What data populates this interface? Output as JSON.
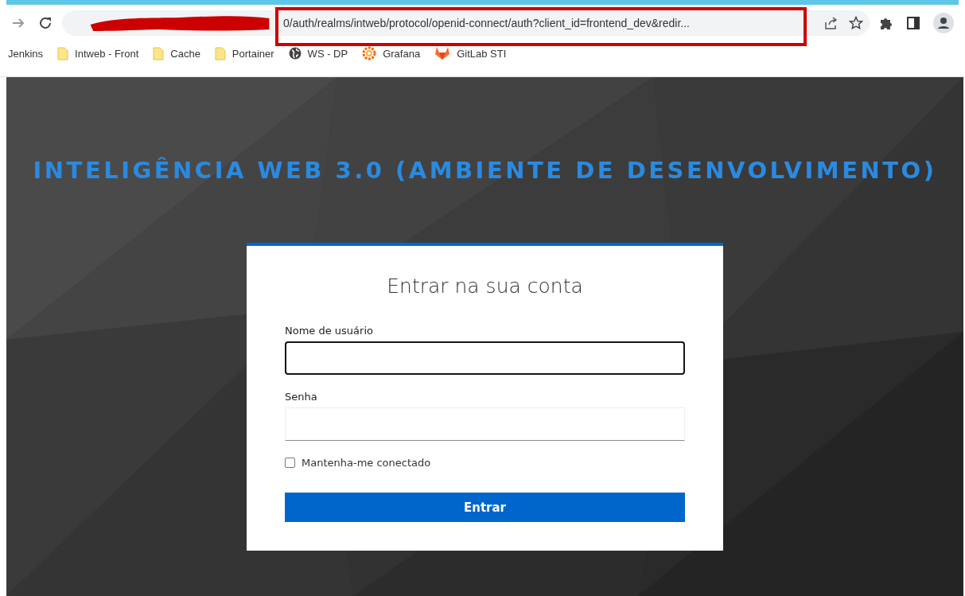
{
  "browser": {
    "url": "0/auth/realms/intweb/protocol/openid-connect/auth?client_id=frontend_dev&redir...",
    "markups": [
      {
        "kind": "redaction"
      },
      {
        "kind": "highlight"
      }
    ],
    "bookmarks": [
      {
        "label": "Jenkins",
        "kind": "plain"
      },
      {
        "label": "Intweb - Front",
        "kind": "folder"
      },
      {
        "label": "Cache",
        "kind": "folder"
      },
      {
        "label": "Portainer",
        "kind": "folder"
      },
      {
        "label": "WS  - DP",
        "kind": "globe"
      },
      {
        "label": "Grafana",
        "kind": "grafana"
      },
      {
        "label": "GitLab STI",
        "kind": "gitlab"
      }
    ]
  },
  "page": {
    "title": "INTELIGÊNCIA WEB 3.0 (AMBIENTE DE DESENVOLVIMENTO)",
    "login": {
      "heading": "Entrar na sua conta",
      "fields": [
        {
          "label": "Nome de usuário",
          "focused": true
        },
        {
          "label": "Senha",
          "focused": false
        }
      ],
      "remember": {
        "label": "Mantenha-me conectado",
        "checked": false
      },
      "submit": "Entrar"
    }
  }
}
